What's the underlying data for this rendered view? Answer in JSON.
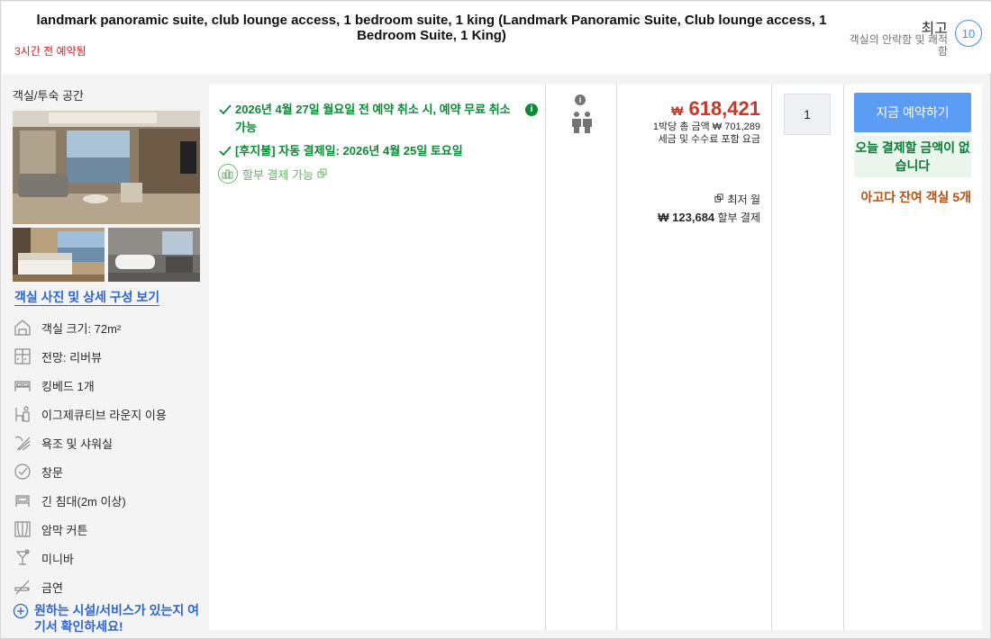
{
  "header": {
    "title": "landmark panoramic suite, club lounge access, 1 bedroom suite, 1 king (Landmark Panoramic Suite, Club lounge access, 1 Bedroom Suite, 1 King)",
    "booked_ago": "3시간 전 예약됨",
    "score_word": "최고",
    "score_sub": "객실의 안락함 및 쾌적함",
    "score": "10"
  },
  "left": {
    "section_title": "객실/투숙 공간",
    "photo_link": "객실 사진 및 상세 구성 보기",
    "amenities": [
      {
        "icon": "room-size-icon",
        "label": "객실 크기: 72m²"
      },
      {
        "icon": "view-icon",
        "label": "전망: 리버뷰"
      },
      {
        "icon": "bed-icon",
        "label": "킹베드 1개"
      },
      {
        "icon": "lounge-icon",
        "label": "이그제큐티브 라운지 이용"
      },
      {
        "icon": "shower-icon",
        "label": "욕조 및 샤워실"
      },
      {
        "icon": "check-circle-icon",
        "label": "창문"
      },
      {
        "icon": "long-bed-icon",
        "label": "긴 침대(2m 이상)"
      },
      {
        "icon": "curtain-icon",
        "label": "암막 커튼"
      },
      {
        "icon": "minibar-icon",
        "label": "미니바"
      },
      {
        "icon": "no-smoking-icon",
        "label": "금연"
      }
    ],
    "more_link": "원하는 시설/서비스가 있는지 여기서 확인하세요!"
  },
  "offer": {
    "benefits": [
      "2026년 4월 27일 월요일 전 예약 취소 시, 예약 무료 취소 가능",
      "[후지불] 자동 결제일: 2026년 4월 25일 토요일"
    ],
    "installment_label": "할부 결제 가능",
    "price_currency": "₩",
    "price": "618,421",
    "price_total": "1박당 총 금액 ₩ 701,289",
    "price_note": "세금 및 수수료 포함 요금",
    "monthly_label": "최저 월",
    "monthly_amount": "₩ 123,684",
    "monthly_suffix": "할부 결제",
    "quantity": "1",
    "book_button": "지금 예약하기",
    "pay_today": "오늘 결제할 금액이 없습니다",
    "rooms_left": "아고다 잔여 객실 5개"
  },
  "colors": {
    "accent_blue": "#5b9cf4",
    "price_red": "#c53829",
    "benefit_green": "#0b8a35",
    "urgency_orange": "#b8500b"
  }
}
